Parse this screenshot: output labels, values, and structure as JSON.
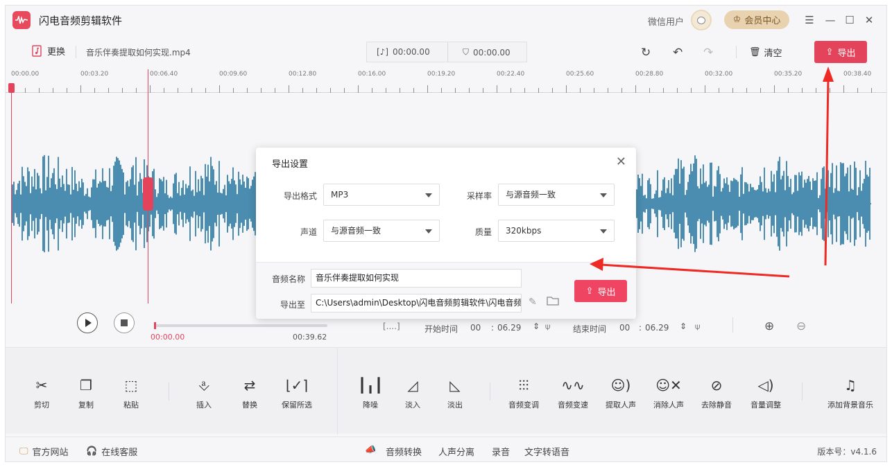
{
  "app": {
    "title": "闪电音频剪辑软件"
  },
  "header": {
    "user_name": "微信用户",
    "vip_label": "会员中心"
  },
  "toolbar": {
    "replace_label": "更换",
    "file_name": "音乐伴奏提取如何实现.mp4",
    "time_start": "00:00.00",
    "time_end": "00:00.00",
    "clear_label": "清空",
    "export_label": "导出"
  },
  "ruler": {
    "labels": [
      "00:00.00",
      "00:03.20",
      "00:06.40",
      "00:09.60",
      "00:12.80",
      "00:16.00",
      "00:19.20",
      "00:22.40",
      "00:25.60",
      "00:28.80",
      "00:32.00",
      "00:35.20",
      "00:38.40"
    ]
  },
  "transport": {
    "current_time": "00:00.00",
    "total_time": "00:39.62",
    "start_label": "开始时间",
    "start_min": "00",
    "start_sec": "06.29",
    "end_label": "结束时间",
    "end_min": "00",
    "end_sec": "06.29",
    "colon": ":"
  },
  "tools": {
    "left": [
      {
        "label": "剪切"
      },
      {
        "label": "复制"
      },
      {
        "label": "粘贴"
      },
      {
        "label": "插入"
      },
      {
        "label": "替换"
      },
      {
        "label": "保留所选"
      }
    ],
    "right": [
      {
        "label": "降噪"
      },
      {
        "label": "淡入"
      },
      {
        "label": "淡出"
      },
      {
        "label": "音频变调"
      },
      {
        "label": "音频变速"
      },
      {
        "label": "提取人声"
      },
      {
        "label": "消除人声"
      },
      {
        "label": "去除静音"
      },
      {
        "label": "音量调整"
      },
      {
        "label": "添加背景音乐"
      }
    ]
  },
  "footer": {
    "website": "官方网站",
    "support": "在线客服",
    "links": [
      "音频转换",
      "人声分离",
      "录音",
      "文字转语音"
    ],
    "version": "版本号：v4.1.6"
  },
  "modal": {
    "title": "导出设置",
    "format_label": "导出格式",
    "format_value": "MP3",
    "samplerate_label": "采样率",
    "samplerate_value": "与源音频一致",
    "channel_label": "声道",
    "channel_value": "与源音频一致",
    "quality_label": "质量",
    "quality_value": "320kbps",
    "name_label": "音频名称",
    "name_value": "音乐伴奏提取如何实现",
    "path_label": "导出至",
    "path_value": "C:\\Users\\admin\\Desktop\\闪电音频剪辑软件\\闪电音频",
    "export_label": "导出"
  },
  "colors": {
    "accent": "#e3445c",
    "waveform": "#4a8db0",
    "vip_bg": "#e9d2b0",
    "annotation": "#ee2a24"
  }
}
